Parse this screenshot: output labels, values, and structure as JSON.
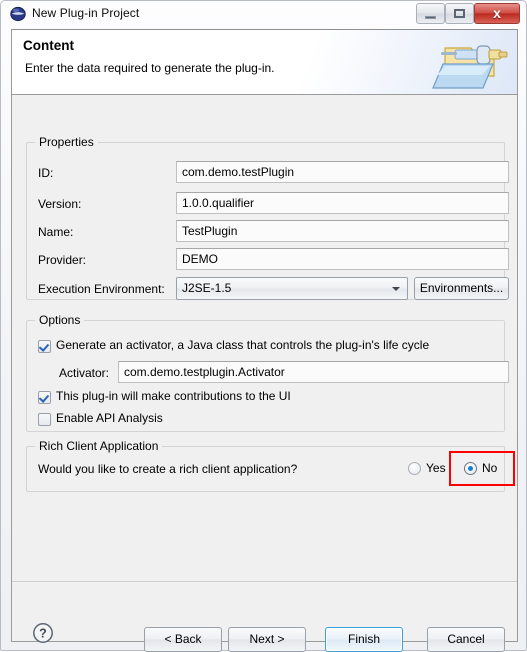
{
  "window": {
    "title": "New Plug-in Project",
    "icon": "eclipse-sphere-icon",
    "controls": {
      "minimize": "minimize-icon",
      "maximize": "restore-icon",
      "close": "x"
    }
  },
  "header": {
    "title": "Content",
    "description": "Enter the data required to generate the plug-in.",
    "graphic": "plugin-folder-icon"
  },
  "properties": {
    "group_title": "Properties",
    "fields": [
      {
        "label": "ID:",
        "value": "com.demo.testPlugin"
      },
      {
        "label": "Version:",
        "value": "1.0.0.qualifier"
      },
      {
        "label": "Name:",
        "value": "TestPlugin"
      },
      {
        "label": "Provider:",
        "value": "DEMO"
      }
    ],
    "execution_environment": {
      "label": "Execution Environment:",
      "value": "J2SE-1.5",
      "button_label": "Environments..."
    }
  },
  "options": {
    "group_title": "Options",
    "generate_activator": {
      "label": "Generate an activator, a Java class that controls the plug-in's life cycle",
      "checked": true
    },
    "activator": {
      "label": "Activator:",
      "value": "com.demo.testplugin.Activator"
    },
    "ui_contributions": {
      "label": "This plug-in will make contributions to the UI",
      "checked": true
    },
    "api_analysis": {
      "label": "Enable API Analysis",
      "checked": false
    }
  },
  "rich_client": {
    "group_title": "Rich Client Application",
    "question": "Would you like to create a rich client application?",
    "options": [
      {
        "label": "Yes",
        "selected": false
      },
      {
        "label": "No",
        "selected": true
      }
    ]
  },
  "footer": {
    "help": "?",
    "buttons": [
      {
        "label": "< Back"
      },
      {
        "label": "Next >"
      },
      {
        "label": "Finish"
      },
      {
        "label": "Cancel"
      }
    ]
  },
  "colors": {
    "annotation": "#ff0000",
    "focus": "#3c9fd6",
    "dialog_bg": "#f0f0f0"
  }
}
